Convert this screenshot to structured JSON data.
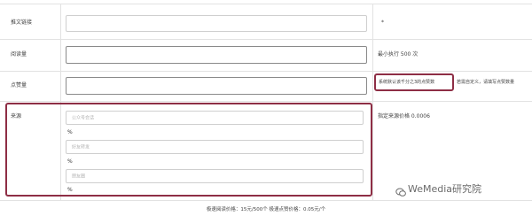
{
  "colors": {
    "highlight": "#8e2e45",
    "border": "#e2e2e2",
    "watermark": "#6a6a6a"
  },
  "rows": {
    "article_link": {
      "label": "推文链接",
      "note": "*"
    },
    "read_count": {
      "label": "阅读量",
      "note": "最小执行 500 次"
    },
    "like_count": {
      "label": "点赞量",
      "note_highlight": "系统默认该千分之3的点赞数",
      "note_rest": "若需自定义，请填写点赞数量"
    },
    "source": {
      "label": "来源",
      "note": "指定来源价格 0.0006",
      "fields": [
        {
          "placeholder": "公众号会话",
          "unit": "%"
        },
        {
          "placeholder": "好友转发",
          "unit": "%"
        },
        {
          "placeholder": "朋友圈",
          "unit": "%"
        }
      ]
    }
  },
  "footer": {
    "price_text": "极速阅读价格：15元/500个 极速点赞价格：0.05元/个"
  },
  "watermark": {
    "icon": "wechat-icon",
    "text": "WeMedia研究院"
  }
}
